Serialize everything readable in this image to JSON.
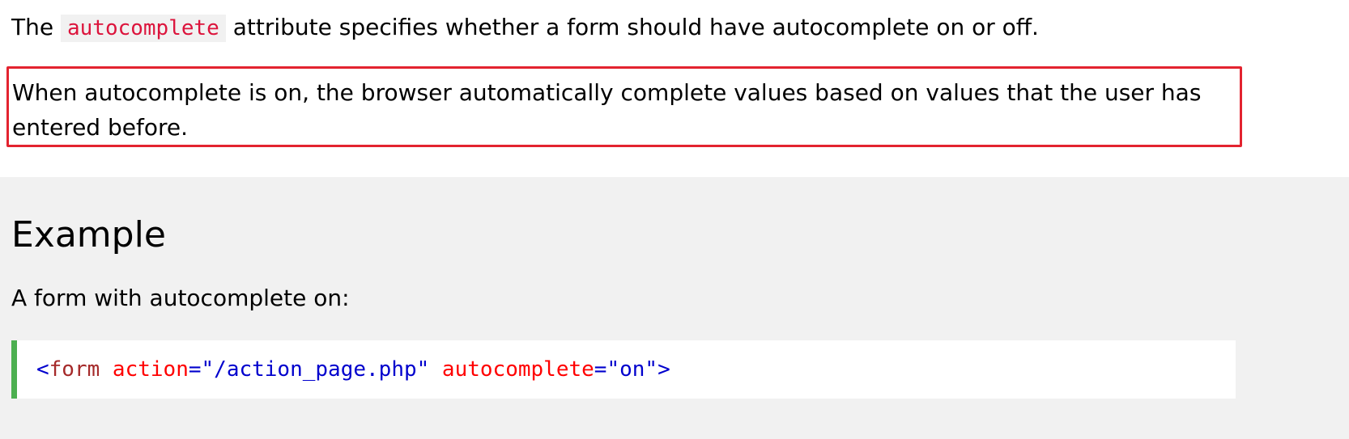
{
  "intro": {
    "before": "The ",
    "code": "autocomplete",
    "after": " attribute specifies whether a form should have autocomplete on or off."
  },
  "highlight": {
    "text": "When autocomplete is on, the browser automatically complete values based on values that the user has entered before."
  },
  "example": {
    "title": "Example",
    "description": "A form with autocomplete on:",
    "code": {
      "open_bracket": "<",
      "tag_name": "form",
      "attr1_name": " action",
      "attr1_eq": "=",
      "attr1_value": "\"/action_page.php\"",
      "attr2_name": " autocomplete",
      "attr2_eq": "=",
      "attr2_value": "\"on\"",
      "close_bracket": ">"
    }
  },
  "colors": {
    "inline_code": "#dc143c",
    "highlight_border": "#e3232f",
    "code_border": "#4caf50",
    "tag": "#0000cd",
    "tag_name": "#a52a2a",
    "attribute": "#ff0000"
  }
}
